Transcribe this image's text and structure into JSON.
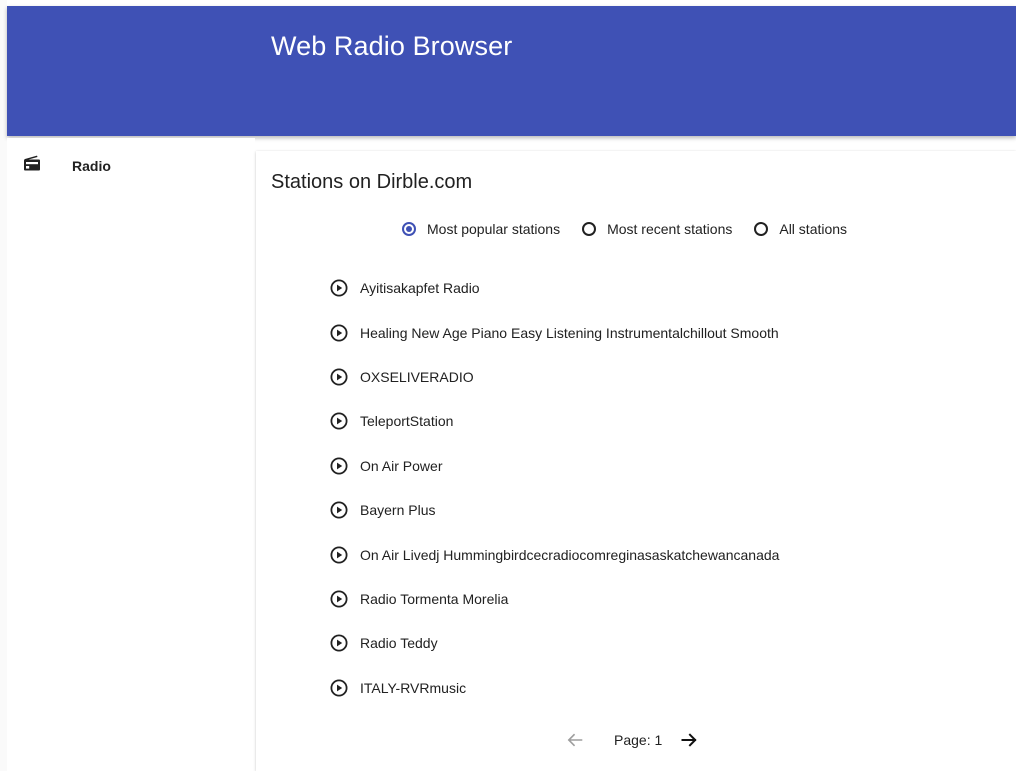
{
  "app": {
    "title": "Web Radio Browser"
  },
  "sidebar": {
    "items": [
      {
        "label": "Radio",
        "icon": "radio-icon"
      }
    ]
  },
  "main": {
    "title": "Stations on Dirble.com",
    "filters": [
      {
        "label": "Most popular stations",
        "selected": true
      },
      {
        "label": "Most recent stations",
        "selected": false
      },
      {
        "label": "All stations",
        "selected": false
      }
    ],
    "stations": [
      "Ayitisakapfet Radio",
      "Healing New Age Piano Easy Listening Instrumentalchillout Smooth",
      "OXSELIVERADIO",
      "TeleportStation",
      "On Air Power",
      "Bayern Plus",
      "On Air Livedj Hummingbirdcecradiocomreginasaskatchewancanada",
      "Radio Tormenta Morelia",
      "Radio Teddy",
      "ITALY-RVRmusic"
    ],
    "pagination": {
      "label": "Page: 1",
      "prev_enabled": false,
      "next_enabled": true
    }
  },
  "colors": {
    "primary": "#3f51b5",
    "text": "#212121",
    "disabled": "#9e9e9e"
  }
}
